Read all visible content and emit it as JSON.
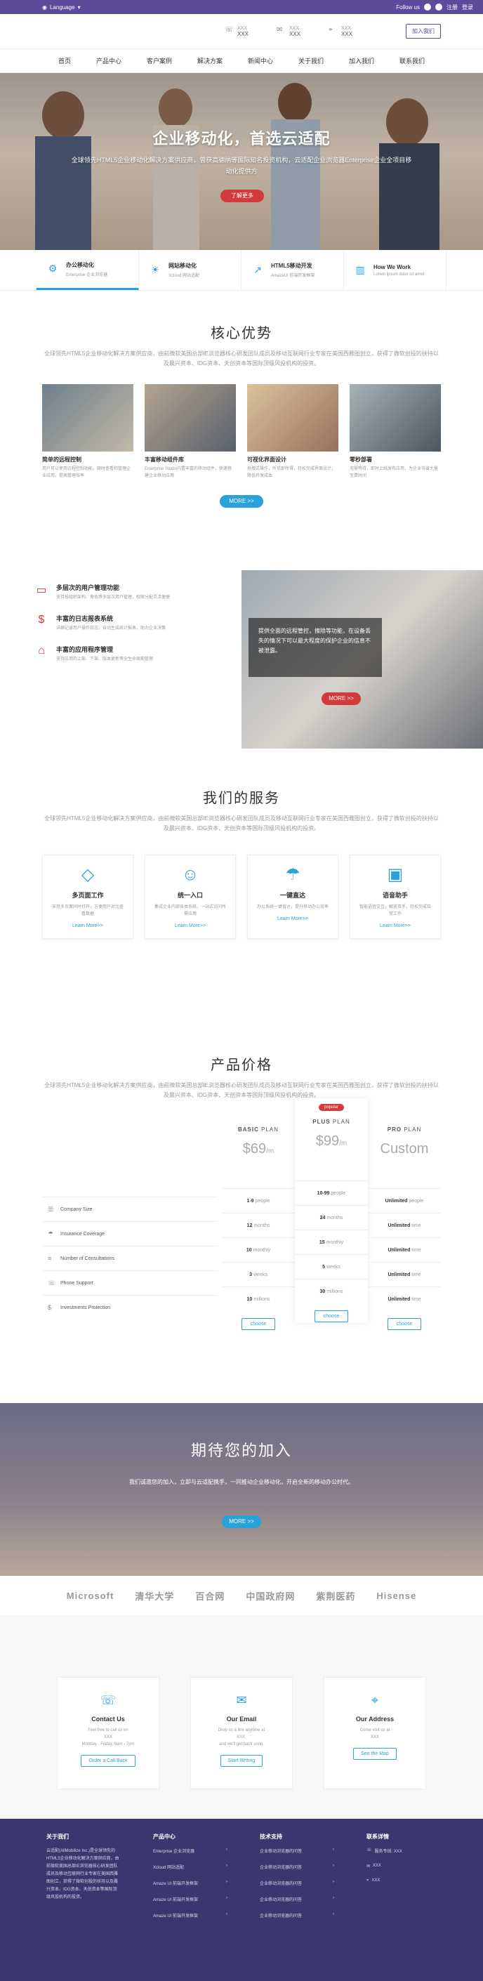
{
  "topbar": {
    "language": "Language",
    "follow_us": "Follow us",
    "register": "注册",
    "login": "登录"
  },
  "header": {
    "contacts": [
      {
        "icon": "phone-icon",
        "label": "XXX",
        "value": "XXX"
      },
      {
        "icon": "mail-icon",
        "label": "XXX",
        "value": "XXX"
      },
      {
        "icon": "location-icon",
        "label": "XXX",
        "value": "XXX"
      }
    ],
    "join_label": "加入我们"
  },
  "nav": [
    "首页",
    "产品中心",
    "客户案例",
    "解决方案",
    "新闻中心",
    "关于我们",
    "加入我们",
    "联系我们"
  ],
  "hero": {
    "title": "企业移动化，首选云适配",
    "subtitle": "全球领先HTML5企业移动化解决方案供应商，曾获高德纳等国际知名投资机构，云适配企业浏览器Enterprise企业全项目移动化提供方",
    "cta": "了解更多"
  },
  "features": [
    {
      "title": "办公移动化",
      "desc": "Enterprise 企业浏览器"
    },
    {
      "title": "网站移动化",
      "desc": "Xcloud 网站适配"
    },
    {
      "title": "HTML5移动开发",
      "desc": "AmazeUI 前端开发框架"
    },
    {
      "title": "How We Work",
      "desc": "Lorem ipsum dolor sit amet"
    }
  ],
  "advantages": {
    "title": "核心优势",
    "desc": "全球领先HTML5企业移动化解决方案供应商，由前微软美国总部IE浏览器核心研发团队成员及移动互联网行业专家在美国西雅图创立，获得了微软创投的扶持以及晨兴资本、IDG资本、天创资本等国际顶级风投机构的投资。",
    "cards": [
      {
        "title": "简单的远程控制",
        "desc": "用户可以使用远程控制功能，随时查看和管理企业应用，提高管理效率"
      },
      {
        "title": "丰富移动组件库",
        "desc": "Enterprise Studio内置丰富的移动组件，快速搭建企业移动应用"
      },
      {
        "title": "可视化界面设计",
        "desc": "拖拽式操作，所见即所得，轻松完成界面设计，降低开发成本"
      },
      {
        "title": "零秒部署",
        "desc": "无需等待，即时上线发布应用，为企业节省大量宝贵时间"
      }
    ],
    "more": "MORE >>"
  },
  "management": {
    "items": [
      {
        "icon": "monitor-icon",
        "title": "多层次的用户管理功能",
        "desc": "支持按组织架构、角色等多层次用户管理，权限分配灵活便捷"
      },
      {
        "icon": "dollar-icon",
        "title": "丰富的日志报表系统",
        "desc": "详细记录用户操作日志，自动生成统计报表，助力企业决策"
      },
      {
        "icon": "bank-icon",
        "title": "丰富的应用程序管理",
        "desc": "支持应用的上架、下架、版本更新等全生命周期管理"
      }
    ],
    "overlay": "提供全面的远程管控，擦除等功能，在设备丢失的情况下可以最大程度的保护企业的信息不被泄露。",
    "more": "MORE >>"
  },
  "services": {
    "title": "我们的服务",
    "desc": "全球领先HTML5企业移动化解决方案供应商，由前微软美国总部IE浏览器核心研发团队成员及移动互联网行业专家在美国西雅图创立，获得了微软创投的扶持以及晨兴资本、IDG资本、天创资本等国际顶级风投机构的投资。",
    "cards": [
      {
        "icon": "diamond-icon",
        "title": "多页面工作",
        "desc": "支持多页面同时打开，方便用户对比查看数据",
        "link": "Learn More>>"
      },
      {
        "icon": "user-icon",
        "title": "统一入口",
        "desc": "集成企业内部各类系统，一站式访问所需应用",
        "link": "Learn More>>"
      },
      {
        "icon": "umbrella-icon",
        "title": "一键直达",
        "desc": "办公系统一键直达，提升移动办公效率",
        "link": "Learn More>>"
      },
      {
        "icon": "briefcase-icon",
        "title": "语音助手",
        "desc": "智能语音交互，解放双手，轻松完成日常工作",
        "link": "Learn More>>"
      }
    ]
  },
  "pricing": {
    "title": "产品价格",
    "desc": "全球领先HTML5企业移动化解决方案供应商，由前微软美国总部IE浏览器核心研发团队成员及移动互联网行业专家在美国西雅图创立，获得了微软创投的扶持以及晨兴资本、IDG资本、天创资本等国际顶级风投机构的投资。",
    "rows": [
      {
        "icon": "group-icon",
        "label": "Company Size"
      },
      {
        "icon": "umbrella-icon",
        "label": "Insurance Coverage"
      },
      {
        "icon": "list-icon",
        "label": "Number of Consultations"
      },
      {
        "icon": "phone-icon",
        "label": "Phone Support"
      },
      {
        "icon": "dollar-icon",
        "label": "Investments Protection"
      }
    ],
    "plans": [
      {
        "name": "BASIC",
        "suffix": "PLAN",
        "price": "$69",
        "per": "/m",
        "cells": [
          [
            "1-9",
            "people"
          ],
          [
            "12",
            "months"
          ],
          [
            "10",
            "monthly"
          ],
          [
            "3",
            "weeks"
          ],
          [
            "10",
            "millions"
          ]
        ],
        "button": "choose"
      },
      {
        "name": "PLUS",
        "suffix": "PLAN",
        "price": "$99",
        "per": "/m",
        "badge": "popular",
        "cells": [
          [
            "10-99",
            "people"
          ],
          [
            "24",
            "months"
          ],
          [
            "15",
            "monthly"
          ],
          [
            "5",
            "weeks"
          ],
          [
            "30",
            "millions"
          ]
        ],
        "button": "choose"
      },
      {
        "name": "PRO",
        "suffix": "PLAN",
        "price": "Custom",
        "per": "",
        "cells": [
          [
            "Unlimited",
            "people"
          ],
          [
            "Unlimited",
            "time"
          ],
          [
            "Unlimited",
            "time"
          ],
          [
            "Unlimited",
            "time"
          ],
          [
            "Unlimited",
            "time"
          ]
        ],
        "button": "choose"
      }
    ]
  },
  "join": {
    "title": "期待您的加入",
    "desc": "我们诚邀您的加入，立即与云适配携手，一同推动企业移动化，开启全新的移动办公时代。",
    "more": "MORE >>"
  },
  "partners": [
    "Microsoft",
    "清华大学",
    "百合网",
    "中国政府网",
    "紫荆医药",
    "Hisense"
  ],
  "contact": {
    "cards": [
      {
        "icon": "phone-icon",
        "title": "Contact Us",
        "desc1": "Feel free to call us on",
        "desc2": "XXX",
        "desc3": "Monday - Friday, 9am - 7pm",
        "button": "Order a Call Back"
      },
      {
        "icon": "mail-icon",
        "title": "Our Email",
        "desc1": "Drop us a line anytime at",
        "desc2": "XXX,",
        "desc3": "and we'll get back soon.",
        "button": "Start Writing"
      },
      {
        "icon": "location-icon",
        "title": "Our Address",
        "desc1": "Come visit us at",
        "desc2": "XXX",
        "desc3": "",
        "button": "See the Map"
      }
    ]
  },
  "footer": {
    "about_title": "关于我们",
    "about_text": "云适配(AllMobilize Inc.)是全球领先的HTML5企业移动化解决方案供应商，由前微软美国总部IE浏览器核心研发团队成员及移动互联网行业专家在美国西雅图创立，获得了微软创投的扶持以及晨兴资本、IDG资本、天创资本等国际顶级风投机构的投资。",
    "products_title": "产品中心",
    "products": [
      "Enterprise 企业浏览器",
      "Xcloud 网站适配",
      "Amaze UI 前端开发框架",
      "Amaze UI 前端开发框架",
      "Amaze UI 前端开发框架"
    ],
    "support_title": "技术支持",
    "support": [
      "企业移动浏览器的问答",
      "企业移动浏览器的问答",
      "企业移动浏览器的问答",
      "企业移动浏览器的问答",
      "企业移动浏览器的问答"
    ],
    "contact_title": "联系详情",
    "contact": [
      "服务专线: XXX",
      "XXX",
      "XXX"
    ]
  }
}
